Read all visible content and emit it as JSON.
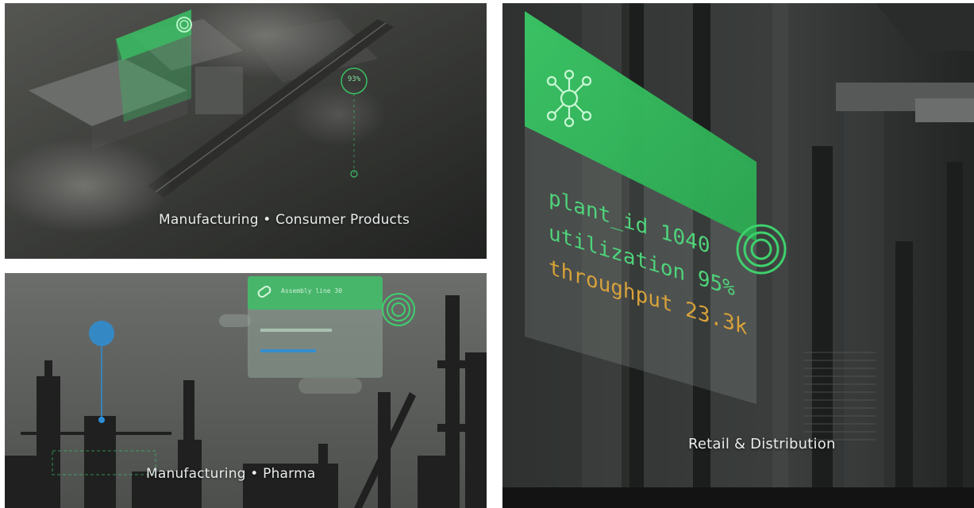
{
  "cards": [
    {
      "caption": "Manufacturing • Consumer Products",
      "badge": "93%"
    },
    {
      "caption": "Manufacturing • Pharma",
      "panel_title": "Assembly line 30"
    },
    {
      "caption": "Retail & Distribution",
      "readout": {
        "line1": "plant_id 1040",
        "line2": "utilization 95%",
        "line3": "throughput 23.3k"
      }
    }
  ],
  "colors": {
    "accent_green": "#39c164",
    "readout_green": "#4fd37a",
    "readout_amber": "#d8a23a",
    "blue_marker": "#2c8fd6"
  },
  "icons": [
    "network-hub-icon",
    "concentric-rings-icon",
    "link-icon"
  ]
}
